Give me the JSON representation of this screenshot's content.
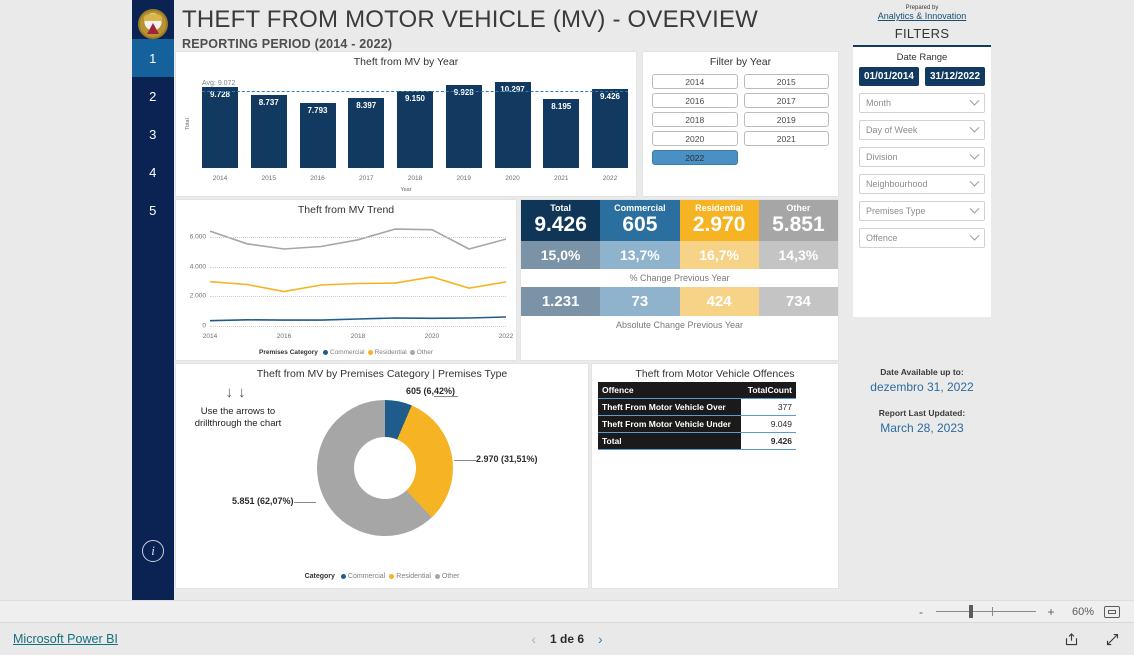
{
  "report": {
    "title": "THEFT FROM MOTOR VEHICLE (MV) - OVERVIEW",
    "subtitle": "REPORTING PERIOD (2014 - 2022)"
  },
  "sidebar": {
    "logo_name": "police-crest-logo",
    "pages": [
      "1",
      "2",
      "3",
      "4",
      "5"
    ],
    "active_page": "1",
    "info_icon": "i"
  },
  "bar_chart": {
    "title": "Theft from MV by Year",
    "y_axis_title": "Total",
    "x_axis_title": "Year",
    "avg_label": "Avg: 9.072"
  },
  "year_filter": {
    "title": "Filter by Year",
    "years": [
      "2014",
      "2015",
      "2016",
      "2017",
      "2018",
      "2019",
      "2020",
      "2021",
      "2022"
    ],
    "selected": "2022"
  },
  "trend_chart": {
    "title": "Theft from MV Trend",
    "legend_title": "Premises Category"
  },
  "kpi": {
    "headers": [
      "Total",
      "Commercial",
      "Residential",
      "Other"
    ],
    "values": [
      "9.426",
      "605",
      "2.970",
      "5.851"
    ],
    "pct_change": [
      "15,0%",
      "13,7%",
      "16,7%",
      "14,3%"
    ],
    "pct_note": "% Change Previous Year",
    "abs_change": [
      "1.231",
      "73",
      "424",
      "734"
    ],
    "abs_note": "Absolute Change Previous Year",
    "colors": [
      "#0f3557",
      "#2a6f9e",
      "#f6b323",
      "#a6a6a6"
    ],
    "pct_colors": [
      "#7a93a7",
      "#8fb3cd",
      "#f7d387",
      "#c4c4c4"
    ],
    "abs_colors": [
      "#7a93a7",
      "#8fb3cd",
      "#f7d387",
      "#c4c4c4"
    ]
  },
  "donut": {
    "title": "Theft from MV by Premises Category | Premises Type",
    "hint_arrows": "↓↓",
    "hint_text": "Use the arrows to drillthrough the chart",
    "labels": [
      "605 (6,42%)",
      "2.970 (31,51%)",
      "5.851 (62,07%)"
    ],
    "legend_title": "Category",
    "legend": [
      "Commercial",
      "Residential",
      "Other"
    ]
  },
  "offences": {
    "title": "Theft from Motor Vehicle Offences",
    "columns": [
      "Offence",
      "TotalCount"
    ],
    "rows": [
      {
        "offence": "Theft From Motor Vehicle Over",
        "count": "377"
      },
      {
        "offence": "Theft From Motor Vehicle Under",
        "count": "9.049"
      }
    ],
    "total_label": "Total",
    "total_count": "9.426"
  },
  "filters_panel": {
    "prepared_by": "Prepared by",
    "prepared_link": "Analytics & Innovation",
    "heading": "FILTERS",
    "date_range_title": "Date Range",
    "date_from": "01/01/2014",
    "date_to": "31/12/2022",
    "slicers": [
      "Month",
      "Day of Week",
      "Division",
      "Neighbourhood",
      "Premises Type",
      "Offence"
    ],
    "available_label": "Date Available up to:",
    "available_value": "dezembro 31, 2022",
    "updated_label": "Report Last Updated:",
    "updated_value": "March 28, 2023"
  },
  "zoombar": {
    "minus": "-",
    "plus": "+",
    "percent": "60%",
    "fit_icon": "fit-to-page-icon"
  },
  "footer": {
    "brand": "Microsoft Power BI",
    "prev_icon": "‹",
    "page_text": "1 de 6",
    "next_icon": "›",
    "share_icon": "share-icon",
    "fullscreen_icon": "fullscreen-icon"
  },
  "chart_data": [
    {
      "type": "bar",
      "title": "Theft from MV by Year",
      "xlabel": "Year",
      "ylabel": "Total",
      "categories": [
        "2014",
        "2015",
        "2016",
        "2017",
        "2018",
        "2019",
        "2020",
        "2021",
        "2022"
      ],
      "values": [
        9728,
        8737,
        7793,
        8397,
        9150,
        9928,
        10297,
        8195,
        9426
      ],
      "value_labels": [
        "9.728",
        "8.737",
        "7.793",
        "8.397",
        "9.150",
        "9.928",
        "10.297",
        "8.195",
        "9.426"
      ],
      "average_line": 9072,
      "average_label": "Avg: 9.072",
      "ylim": [
        0,
        11000
      ],
      "grid": false,
      "legend": "none"
    },
    {
      "type": "line",
      "title": "Theft from MV Trend",
      "xlabel": "",
      "ylabel": "",
      "x": [
        "2014",
        "2015",
        "2016",
        "2017",
        "2018",
        "2019",
        "2020",
        "2021",
        "2022"
      ],
      "xtick_labels": [
        "2014",
        "2016",
        "2018",
        "2020",
        "2022"
      ],
      "ytick_labels": [
        "0",
        "2.000",
        "4.000",
        "6.000"
      ],
      "ylim": [
        0,
        7000
      ],
      "grid": true,
      "legend": "bottom",
      "legend_title": "Premises Category",
      "series": [
        {
          "name": "Commercial",
          "color": "#1f5c8b",
          "values": [
            360,
            420,
            400,
            400,
            470,
            540,
            520,
            540,
            605
          ]
        },
        {
          "name": "Residential",
          "color": "#f6b323",
          "values": [
            2980,
            2790,
            2320,
            2760,
            2860,
            2890,
            3300,
            2546,
            2970
          ]
        },
        {
          "name": "Other",
          "color": "#a6a6a6",
          "values": [
            6390,
            5530,
            5180,
            5350,
            5800,
            6520,
            6480,
            5180,
            5851
          ]
        }
      ]
    },
    {
      "type": "pie",
      "title": "Theft from MV by Premises Category | Premises Type",
      "legend": "bottom",
      "legend_title": "Category",
      "labels": [
        "Commercial",
        "Residential",
        "Other"
      ],
      "values": [
        605,
        2970,
        5851
      ],
      "percents": [
        6.42,
        31.51,
        62.07
      ],
      "data_labels": [
        "605 (6,42%)",
        "2.970 (31,51%)",
        "5.851 (62,07%)"
      ],
      "colors": [
        "#1f5c8b",
        "#f6b323",
        "#a6a6a6"
      ],
      "donut": true
    },
    {
      "type": "table",
      "title": "Theft from Motor Vehicle Offences",
      "columns": [
        "Offence",
        "TotalCount"
      ],
      "rows": [
        [
          "Theft From Motor Vehicle Over",
          "377"
        ],
        [
          "Theft From Motor Vehicle Under",
          "9.049"
        ],
        [
          "Total",
          "9.426"
        ]
      ]
    }
  ]
}
